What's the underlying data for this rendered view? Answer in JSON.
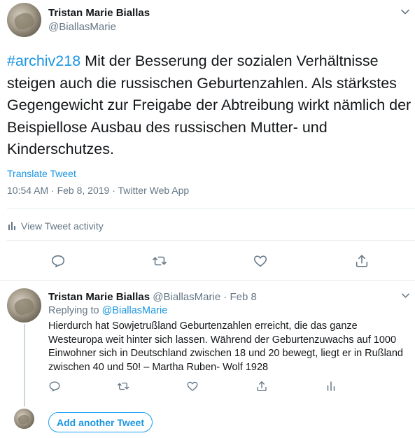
{
  "tweet": {
    "author_name": "Tristan Marie Biallas",
    "author_handle": "@BiallasMarie",
    "hashtag": "#archiv218",
    "text": " Mit der Besserung der sozialen Verhältnisse steigen auch die russischen Geburtenzahlen. Als stärkstes Gegengewicht zur Freigabe der Abtreibung wirkt nämlich der Beispiellose Ausbau des russischen Mutter- und Kinderschutzes.",
    "translate_label": "Translate Tweet",
    "meta": "10:54 AM · Feb 8, 2019 · Twitter Web App",
    "activity_label": "View Tweet activity"
  },
  "reply": {
    "author_name": "Tristan Marie Biallas",
    "author_handle": "@BiallasMarie",
    "separator": " · ",
    "date": "Feb 8",
    "replying_prefix": "Replying to ",
    "replying_handle": "@BiallasMarie",
    "text": "Hierdurch hat Sowjetrußland Geburtenzahlen erreicht, die das ganze Westeuropa weit hinter sich lassen. Während der Geburtenzuwachs auf 1000 Einwohner sich in Deutschland zwischen 18 und 20 bewegt, liegt er in Rußland zwischen 40 und 50! – Martha Ruben- Wolf 1928"
  },
  "composer": {
    "add_tweet_label": "Add another Tweet"
  },
  "icons": [
    "chevron-down-icon",
    "stats-icon",
    "reply-icon",
    "retweet-icon",
    "like-icon",
    "share-icon"
  ],
  "colors": {
    "link": "#1b95e0",
    "muted": "#657786",
    "text": "#14171a",
    "divider": "#e6ecf0",
    "button_border": "#1da1f2"
  }
}
